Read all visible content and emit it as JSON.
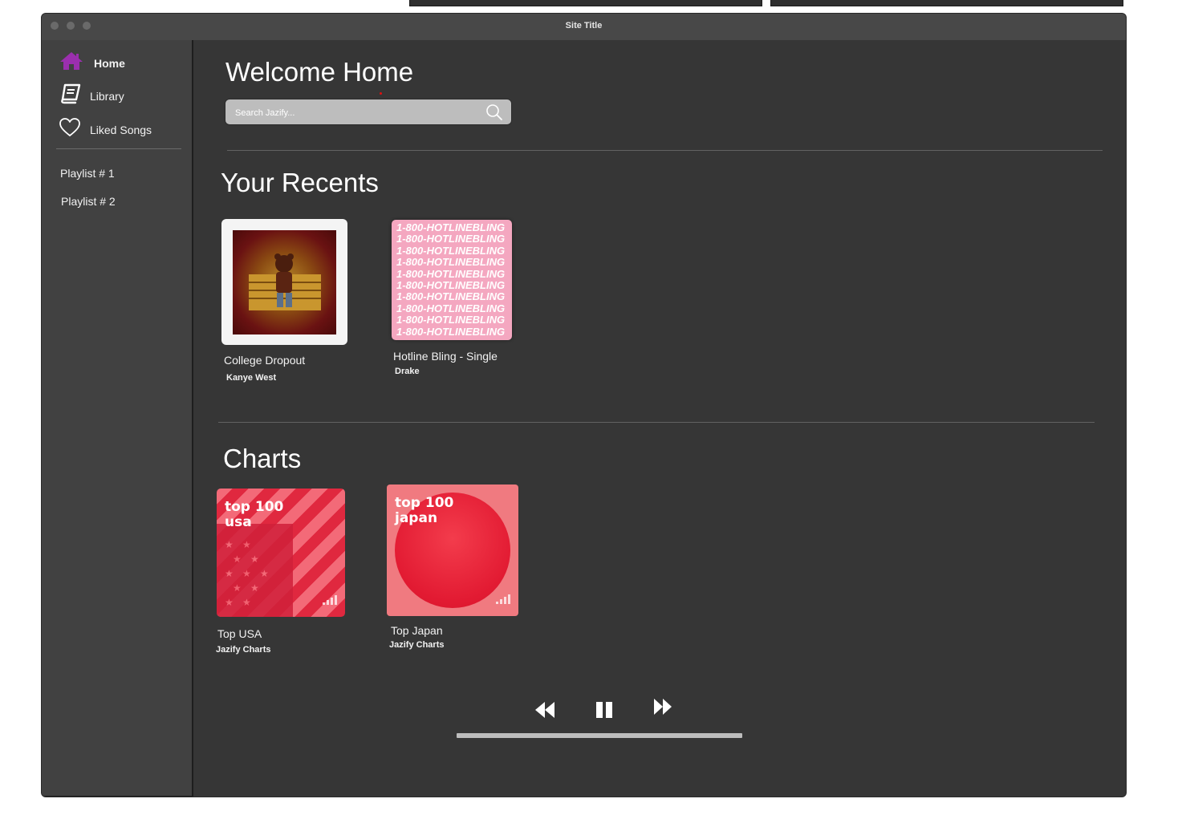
{
  "window": {
    "title": "Site Title"
  },
  "sidebar": {
    "items": [
      {
        "label": "Home",
        "icon": "home-icon",
        "active": true,
        "color": "#9b2fae"
      },
      {
        "label": "Library",
        "icon": "book-icon"
      },
      {
        "label": "Liked Songs",
        "icon": "heart-icon"
      }
    ],
    "playlists": [
      {
        "label": "Playlist # 1"
      },
      {
        "label": "Playlist # 2"
      }
    ]
  },
  "main": {
    "welcome_title": "Welcome Home",
    "search": {
      "placeholder": "Search Jazify...",
      "value": "",
      "icon": "search-icon"
    },
    "recents": {
      "title": "Your Recents",
      "items": [
        {
          "title": "College Dropout",
          "artist": "Kanye West"
        },
        {
          "title": "Hotline Bling - Single",
          "artist": "Drake",
          "art_text": "1-800-HOTLINEBLING"
        }
      ]
    },
    "charts": {
      "title": "Charts",
      "items": [
        {
          "title": "Top USA",
          "subtitle": "Jazify Charts",
          "art_line1": "top 100",
          "art_line2": "usa"
        },
        {
          "title": "Top Japan",
          "subtitle": "Jazify Charts",
          "art_line1": "top 100",
          "art_line2": "japan"
        }
      ]
    }
  },
  "player": {
    "controls": [
      "rewind-icon",
      "pause-icon",
      "fast-forward-icon"
    ],
    "progress": 0
  }
}
